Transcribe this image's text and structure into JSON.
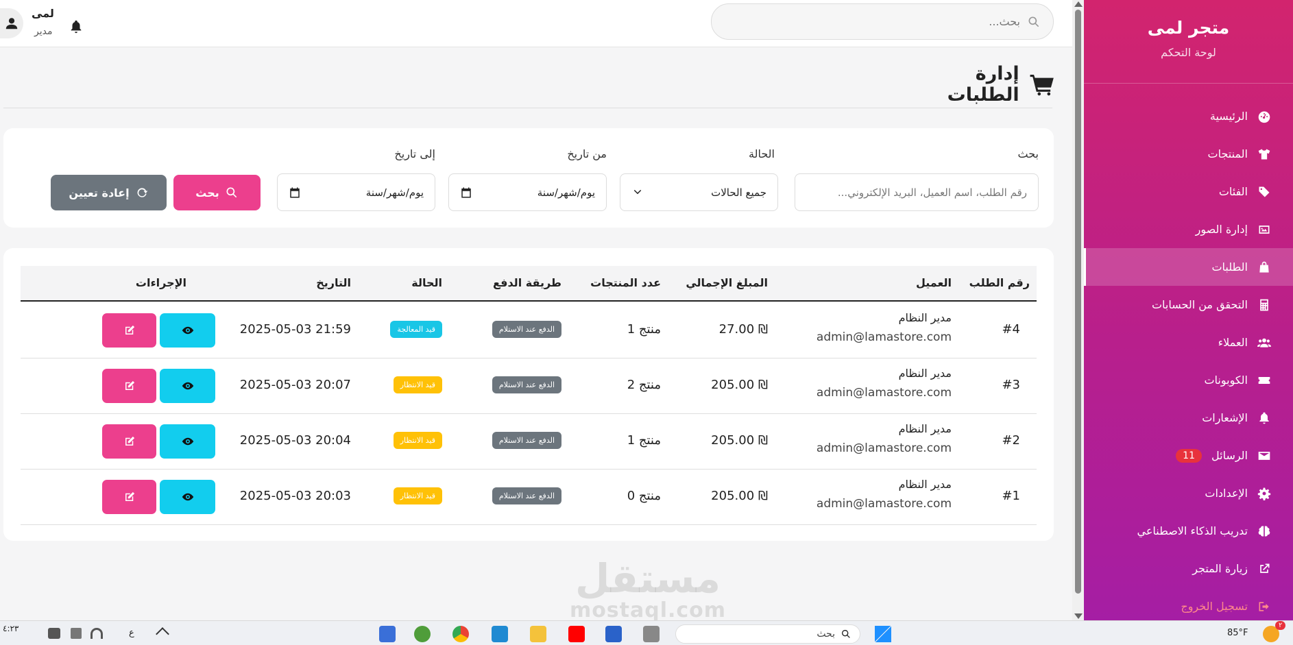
{
  "sidebar": {
    "brand_title": "متجر لمى",
    "brand_subtitle": "لوحة التحكم",
    "items": [
      {
        "label": "الرئيسية",
        "icon": "dashboard-icon"
      },
      {
        "label": "المنتجات",
        "icon": "shirt-icon"
      },
      {
        "label": "الفئات",
        "icon": "tags-icon"
      },
      {
        "label": "إدارة الصور",
        "icon": "images-icon"
      },
      {
        "label": "الطلبات",
        "icon": "bag-icon",
        "active": true
      },
      {
        "label": "التحقق من الحسابات",
        "icon": "calculator-icon"
      },
      {
        "label": "العملاء",
        "icon": "users-icon"
      },
      {
        "label": "الكوبونات",
        "icon": "ticket-icon"
      },
      {
        "label": "الإشعارات",
        "icon": "bell-icon"
      },
      {
        "label": "الرسائل",
        "icon": "envelope-icon",
        "badge": "11"
      },
      {
        "label": "الإعدادات",
        "icon": "gear-icon"
      },
      {
        "label": "تدريب الذكاء الاصطناعي",
        "icon": "brain-icon"
      },
      {
        "label": "زيارة المتجر",
        "icon": "external-link-icon"
      },
      {
        "label": "تسجيل الخروج",
        "icon": "logout-icon"
      }
    ]
  },
  "topbar": {
    "search_placeholder": "بحث...",
    "user_name": "لمى",
    "user_role": "مدير"
  },
  "page": {
    "title": "إدارة الطلبات"
  },
  "filters": {
    "search_label": "بحث",
    "search_placeholder": "رقم الطلب، اسم العميل، البريد الإلكتروني...",
    "status_label": "الحالة",
    "status_value": "جميع الحالات",
    "from_label": "من تاريخ",
    "from_placeholder": "يوم/شهر/سنة",
    "to_label": "إلى تاريخ",
    "to_placeholder": "يوم/شهر/سنة",
    "search_button": "بحث",
    "reset_button": "إعادة تعيين"
  },
  "table": {
    "headers": {
      "order_no": "رقم الطلب",
      "customer": "العميل",
      "total": "المبلغ الإجمالي",
      "items": "عدد المنتجات",
      "payment": "طريقة الدفع",
      "status": "الحالة",
      "date": "التاريخ",
      "actions": "الإجراءات"
    },
    "rows": [
      {
        "order_no": "#4",
        "customer_name": "مدير النظام",
        "customer_email": "admin@lamastore.com",
        "total": "27.00 ₪",
        "items": "1 منتج",
        "payment": "الدفع عند الاستلام",
        "status": "قيد المعالجة",
        "status_color": "#19c6e6",
        "date": "2025-05-03 21:59"
      },
      {
        "order_no": "#3",
        "customer_name": "مدير النظام",
        "customer_email": "admin@lamastore.com",
        "total": "205.00 ₪",
        "items": "2 منتج",
        "payment": "الدفع عند الاستلام",
        "status": "قيد الانتظار",
        "status_color": "#ffc107",
        "date": "2025-05-03 20:07"
      },
      {
        "order_no": "#2",
        "customer_name": "مدير النظام",
        "customer_email": "admin@lamastore.com",
        "total": "205.00 ₪",
        "items": "1 منتج",
        "payment": "الدفع عند الاستلام",
        "status": "قيد الانتظار",
        "status_color": "#ffc107",
        "date": "2025-05-03 20:04"
      },
      {
        "order_no": "#1",
        "customer_name": "مدير النظام",
        "customer_email": "admin@lamastore.com",
        "total": "205.00 ₪",
        "items": "0 منتج",
        "payment": "الدفع عند الاستلام",
        "status": "قيد الانتظار",
        "status_color": "#ffc107",
        "date": "2025-05-03 20:03"
      }
    ]
  },
  "watermark": {
    "line1": "مستقل",
    "line2": "mostaql.com"
  },
  "taskbar": {
    "search_text": "بحث",
    "weather": "85°F",
    "notification_count": "٢",
    "clock": "٤:٢٣",
    "lang": "ع"
  },
  "colors": {
    "sidebar_top": "#d2246e",
    "sidebar_bottom": "#a51ea4",
    "primary_pink": "#ec3f8d",
    "cyan": "#12cdee",
    "gray": "#6c757d",
    "warning": "#ffc107",
    "info": "#19c6e6",
    "danger": "#e8323c"
  }
}
